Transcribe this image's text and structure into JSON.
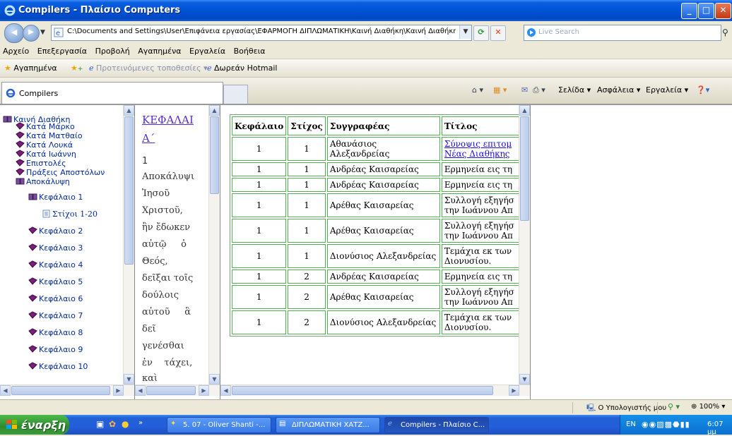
{
  "window": {
    "title": "Compilers - Πλαίσιο Computers",
    "controls": [
      "minimize",
      "maximize",
      "close"
    ]
  },
  "addressbar": {
    "url": "C:\\Documents and Settings\\User\\Επιφάνεια εργασίας\\ΕΦΑΡΜΟΓΗ ΔΙΠΛΩΜΑΤΙΚΗ\\Καινή Διαθήκη\\Καινή Διαθήκη.l",
    "search_placeholder": "Live Search"
  },
  "menu": {
    "items": [
      "Αρχείο",
      "Επεξεργασία",
      "Προβολή",
      "Αγαπημένα",
      "Εργαλεία",
      "Βοήθεια"
    ]
  },
  "favorites": {
    "label": "Αγαπημένα",
    "suggested": "Προτεινόμενες τοποθεσίες",
    "hotmail": "Δωρεάν Hotmail"
  },
  "tabs": {
    "active_label": "Compilers",
    "page": "Σελίδα",
    "safety": "Ασφάλεια",
    "tools": "Εργαλεία"
  },
  "tree": {
    "root": "Καινή Διαθήκη",
    "books": [
      "Κατά Μάρκο",
      "Κατά Ματθαίο",
      "Κατά Λουκά",
      "Κατά Ιωάννη",
      "Επιστολές",
      "Πράξεις Αποστόλων",
      "Αποκάλυψη"
    ],
    "open_chapter": "Κεφάλαιο 1",
    "verses": "Στίχοι 1-20",
    "chapters": [
      "Κεφάλαιο 2",
      "Κεφάλαιο 3",
      "Κεφάλαιο 4",
      "Κεφάλαιο 5",
      "Κεφάλαιο 6",
      "Κεφάλαιο 7",
      "Κεφάλαιο 8",
      "Κεφάλαιο 9",
      "Κεφάλαιο 10"
    ]
  },
  "textframe": {
    "heading_1": "ΚΕΦΑΛΑΙ",
    "heading_2": "Α΄",
    "verse_no": "1",
    "lines": [
      "Αποκάλυψι",
      "Ἰησοῦ",
      "Χριστοῦ,",
      "ἣν ἔδωκεν",
      "αὐτῷ     ὁ",
      "Θεός,",
      "δεῖξαι τοῖς",
      "δούλοις",
      "αὐτοῦ     ἃ",
      "δεῖ",
      "γενέσθαι",
      "ἐν    τάχει,",
      "καὶ"
    ]
  },
  "table": {
    "headers": [
      "Κεφάλαιο",
      "Στίχος",
      "Συγγραφέας",
      "Τίτλος"
    ],
    "rows": [
      {
        "chapter": "1",
        "verse": "1",
        "author": "Αθανάσιος Αλεξανδρείας",
        "title": "Σύνοψις επιτομ Νέας Διαθήκης",
        "link": true
      },
      {
        "chapter": "1",
        "verse": "1",
        "author": "Ανδρέας Καισαρείας",
        "title": "Ερμηνεία εις τη",
        "link": false
      },
      {
        "chapter": "1",
        "verse": "1",
        "author": "Ανδρέας Καισαρείας",
        "title": "Ερμηνεία εις τη",
        "link": false
      },
      {
        "chapter": "1",
        "verse": "1",
        "author": "Αρέθας Καισαρείας",
        "title": "Συλλογή εξηγήσ την Ιωάννου Απ",
        "link": false
      },
      {
        "chapter": "1",
        "verse": "1",
        "author": "Αρέθας Καισαρείας",
        "title": "Συλλογή εξηγήσ την Ιωάννου Απ",
        "link": false
      },
      {
        "chapter": "1",
        "verse": "1",
        "author": "Διονύσιος Αλεξανδρείας",
        "title": "Τεμάχια εκ των Διονυσίου.",
        "link": false
      },
      {
        "chapter": "1",
        "verse": "2",
        "author": "Ανδρέας Καισαρείας",
        "title": "Ερμηνεία εις τη",
        "link": false
      },
      {
        "chapter": "1",
        "verse": "2",
        "author": "Αρέθας Καισαρείας",
        "title": "Συλλογή εξηγήσ την Ιωάννου Απ",
        "link": false
      },
      {
        "chapter": "1",
        "verse": "2",
        "author": "Διονύσιος Αλεξανδρείας",
        "title": "Τεμάχια εκ των Διονυσίου.",
        "link": false
      }
    ]
  },
  "statusbar": {
    "zone": "Ο Υπολογιστής μου",
    "zoom": "100%"
  },
  "taskbar": {
    "start": "έναρξη",
    "tasks": [
      "5. 07 - Oliver Shanti -...",
      "ΔΙΠΛΩΜΑΤΙΚΗ ΧΑΤΖ...",
      "Compilers - Πλαίσιο C..."
    ],
    "lang": "EN",
    "clock": "6:07 μμ"
  },
  "colors": {
    "title_blue": "#0052d6",
    "link_purple": "#5a2ad0",
    "tree_gem": "#7a1f7a",
    "grid_green": "#4fb04f"
  }
}
